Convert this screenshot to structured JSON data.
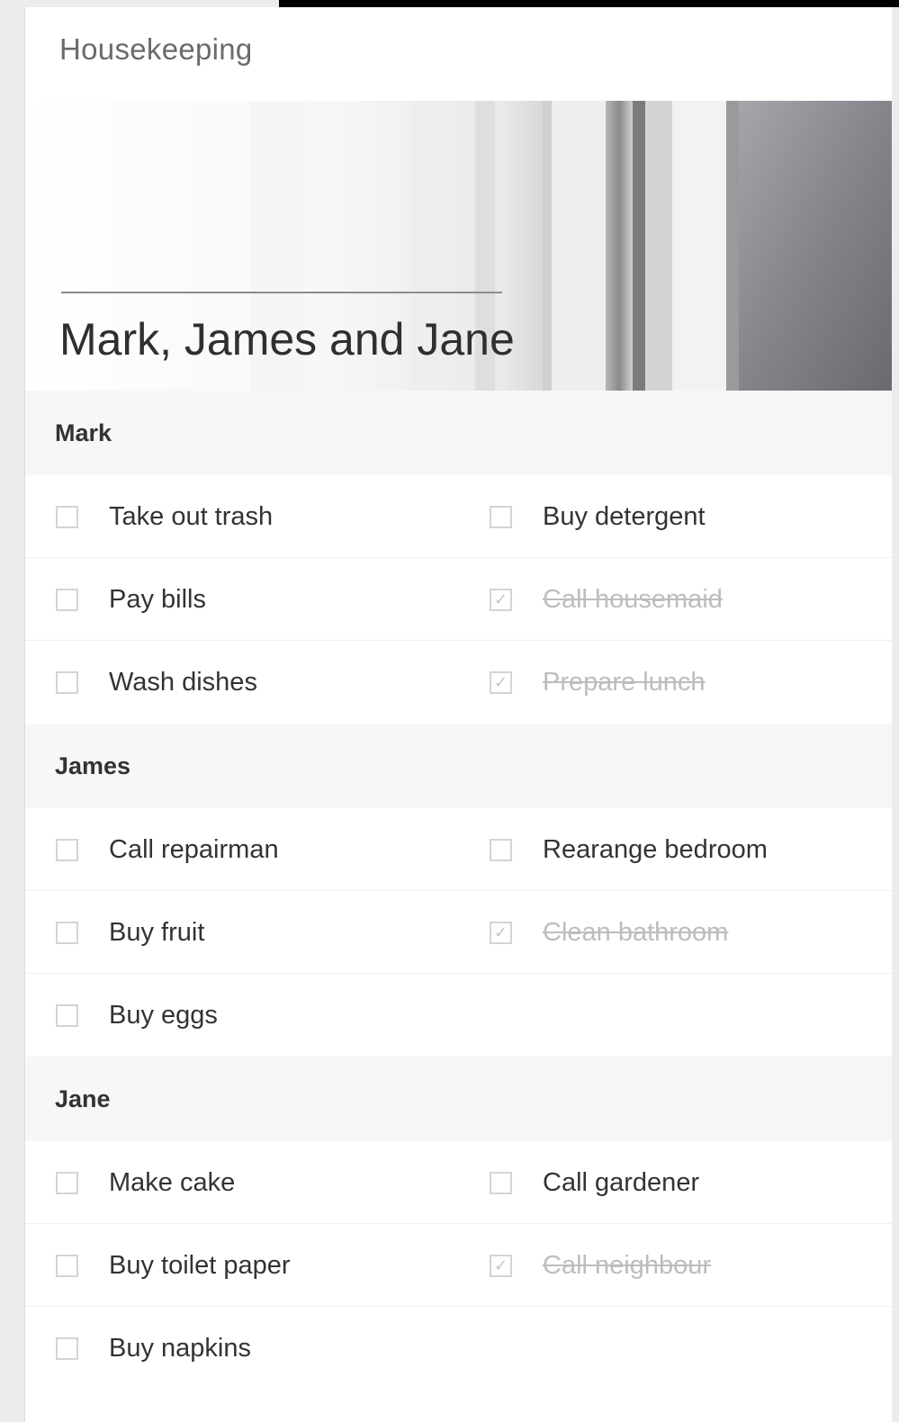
{
  "app": {
    "title": "Housekeeping"
  },
  "hero": {
    "title": "Mark, James and Jane"
  },
  "groups": [
    {
      "name": "Mark",
      "rows": [
        [
          {
            "label": "Take out trash",
            "done": false
          },
          {
            "label": "Buy detergent",
            "done": false
          }
        ],
        [
          {
            "label": "Pay bills",
            "done": false
          },
          {
            "label": "Call housemaid",
            "done": true
          }
        ],
        [
          {
            "label": "Wash dishes",
            "done": false
          },
          {
            "label": "Prepare lunch",
            "done": true
          }
        ]
      ]
    },
    {
      "name": "James",
      "rows": [
        [
          {
            "label": "Call repairman",
            "done": false
          },
          {
            "label": "Rearange bedroom",
            "done": false
          }
        ],
        [
          {
            "label": "Buy fruit",
            "done": false
          },
          {
            "label": "Clean bathroom",
            "done": true
          }
        ],
        [
          {
            "label": "Buy eggs",
            "done": false
          }
        ]
      ]
    },
    {
      "name": "Jane",
      "rows": [
        [
          {
            "label": "Make cake",
            "done": false
          },
          {
            "label": "Call gardener",
            "done": false
          }
        ],
        [
          {
            "label": "Buy toilet paper",
            "done": false
          },
          {
            "label": "Call neighbour",
            "done": true
          }
        ],
        [
          {
            "label": "Buy napkins",
            "done": false
          }
        ]
      ]
    }
  ],
  "icons": {
    "checked": "checkmark-icon"
  },
  "colors": {
    "done_text": "#bdbdbd",
    "text": "#333333",
    "header_bg": "#f7f7f8"
  }
}
